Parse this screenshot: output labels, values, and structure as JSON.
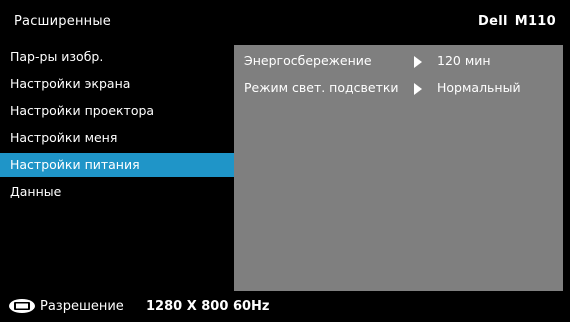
{
  "header": {
    "title": "Расширенные",
    "brand": "Dell",
    "model": "M110"
  },
  "sidebar": {
    "items": [
      {
        "label": "Пар-ры изобр."
      },
      {
        "label": "Настройки экрана"
      },
      {
        "label": "Настройки проектора"
      },
      {
        "label": "Настройки меня"
      },
      {
        "label": "Настройки питания",
        "active": true
      },
      {
        "label": "Данные"
      }
    ]
  },
  "panel": {
    "rows": [
      {
        "label": "Энергосбережение",
        "value": "120 мин"
      },
      {
        "label": "Режим свет. подсветки",
        "value": "Нормальный"
      }
    ]
  },
  "footer": {
    "icon": "display-icon",
    "label": "Разрешение",
    "resolution": "1280 X 800",
    "rate": "60Hz"
  },
  "colors": {
    "background": "#000000",
    "active_item": "#1f95c8",
    "panel": "#7f7f7f",
    "text": "#ffffff"
  }
}
